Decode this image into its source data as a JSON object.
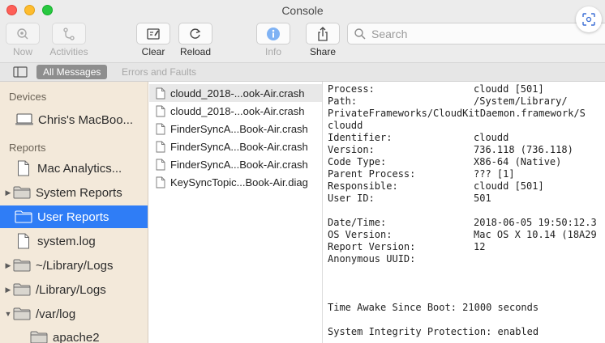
{
  "window": {
    "title": "Console"
  },
  "toolbar": {
    "now_label": "Now",
    "activities_label": "Activities",
    "clear_label": "Clear",
    "reload_label": "Reload",
    "info_label": "Info",
    "share_label": "Share",
    "search_placeholder": "Search",
    "search_value": ""
  },
  "filterbar": {
    "all_messages": "All Messages",
    "errors_and_faults": "Errors and Faults"
  },
  "sidebar": {
    "devices_header": "Devices",
    "device": "Chris's MacBoo...",
    "reports_header": "Reports",
    "items": [
      {
        "label": "Mac Analytics...",
        "icon": "document-icon"
      },
      {
        "label": "System Reports",
        "icon": "folder-icon",
        "disclosure": "collapsed"
      },
      {
        "label": "User Reports",
        "icon": "folder-icon",
        "selected": true
      },
      {
        "label": "system.log",
        "icon": "document-icon"
      },
      {
        "label": "~/Library/Logs",
        "icon": "folder-icon",
        "disclosure": "collapsed"
      },
      {
        "label": "/Library/Logs",
        "icon": "folder-icon",
        "disclosure": "collapsed"
      },
      {
        "label": "/var/log",
        "icon": "folder-icon",
        "disclosure": "expanded"
      },
      {
        "label": "apache2",
        "icon": "folder-icon"
      }
    ]
  },
  "files": [
    {
      "name": "cloudd_2018-...ook-Air.crash",
      "selected": true
    },
    {
      "name": "cloudd_2018-...ook-Air.crash"
    },
    {
      "name": "FinderSyncA...Book-Air.crash"
    },
    {
      "name": "FinderSyncA...Book-Air.crash"
    },
    {
      "name": "FinderSyncA...Book-Air.crash"
    },
    {
      "name": "KeySyncTopic...Book-Air.diag"
    }
  ],
  "report": {
    "process_label": "Process:",
    "process_value": "cloudd [501]",
    "path_label": "Path:",
    "path_value": "/System/Library/",
    "path_cont": "PrivateFrameworks/CloudKitDaemon.framework/S",
    "path_cont2": "cloudd",
    "identifier_label": "Identifier:",
    "identifier_value": "cloudd",
    "version_label": "Version:",
    "version_value": "736.118 (736.118)",
    "codetype_label": "Code Type:",
    "codetype_value": "X86-64 (Native)",
    "parent_label": "Parent Process:",
    "parent_value": "??? [1]",
    "responsible_label": "Responsible:",
    "responsible_value": "cloudd [501]",
    "userid_label": "User ID:",
    "userid_value": "501",
    "datetime_label": "Date/Time:",
    "datetime_value": "2018-06-05 19:50:12.3",
    "osversion_label": "OS Version:",
    "osversion_value": "Mac OS X 10.14 (18A29",
    "reportversion_label": "Report Version:",
    "reportversion_value": "12",
    "uuid_label": "Anonymous UUID:",
    "awake_line": "Time Awake Since Boot: 21000 seconds",
    "sip_line": "System Integrity Protection: enabled"
  },
  "colors": {
    "selection_blue": "#2f7df6",
    "sidebar_bg": "#f3e9da",
    "info_blue": "#3b8ef2"
  }
}
